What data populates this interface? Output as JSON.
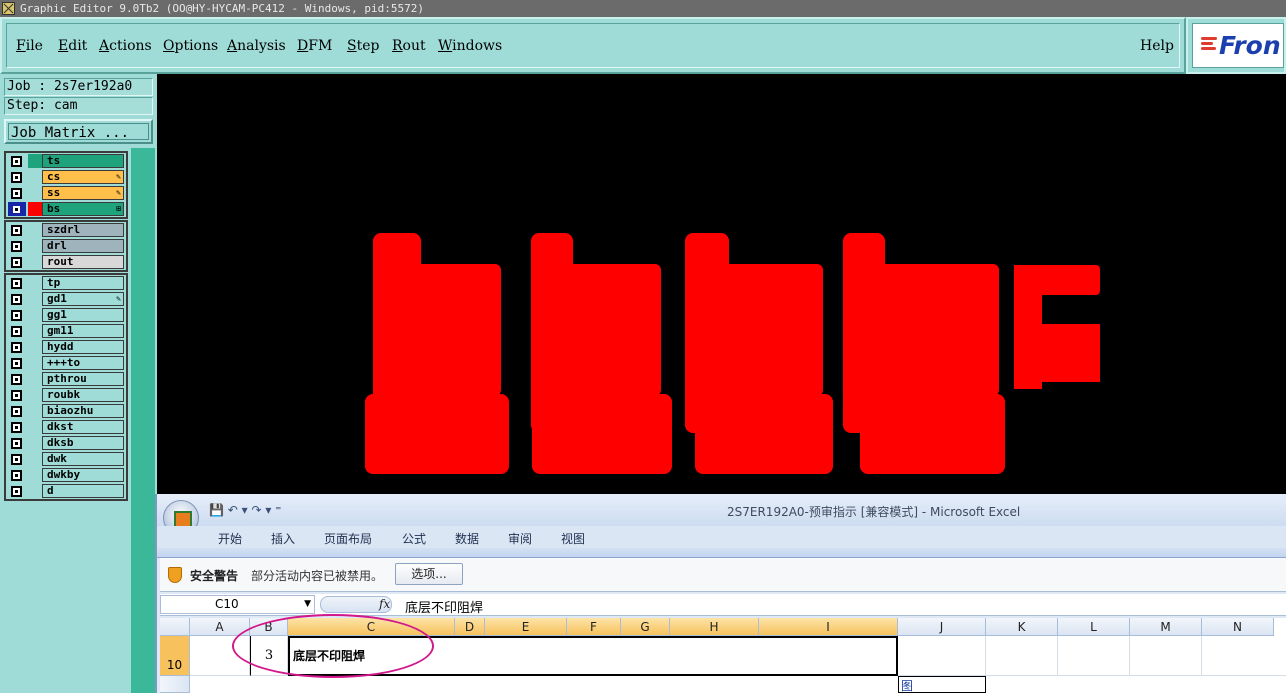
{
  "window": {
    "title": "Graphic Editor 9.0Tb2 (OO@HY-HYCAM-PC412 - Windows, pid:5572)"
  },
  "menu": {
    "items": [
      {
        "label": "File",
        "key": "F",
        "rest": "ile"
      },
      {
        "label": "Edit",
        "key": "E",
        "rest": "dit"
      },
      {
        "label": "Actions",
        "key": "A",
        "rest": "ctions"
      },
      {
        "label": "Options",
        "key": "O",
        "rest": "ptions"
      },
      {
        "label": "Analysis",
        "key": "A",
        "rest": "nalysis"
      },
      {
        "label": "DFM",
        "key": "D",
        "rest": "FM"
      },
      {
        "label": "Step",
        "key": "S",
        "rest": "tep"
      },
      {
        "label": "Rout",
        "key": "R",
        "rest": "out"
      },
      {
        "label": "Windows",
        "key": "W",
        "rest": "indows"
      }
    ],
    "help": "Help"
  },
  "logo": {
    "text": "Fron"
  },
  "panel": {
    "job": "Job : 2s7er192a0",
    "step": "Step: cam",
    "job_matrix": "Job Matrix ..."
  },
  "layers": {
    "group1": [
      {
        "name": "ts",
        "color": "#1fa37c",
        "flag": ""
      },
      {
        "name": "cs",
        "color": "#ffbf4a",
        "flag": "✎"
      },
      {
        "name": "ss",
        "color": "#ffbf4a",
        "flag": "✎"
      },
      {
        "name": "bs",
        "color": "#1fa37c",
        "flag": "⊞"
      }
    ],
    "group2": [
      {
        "name": "szdrl",
        "color": "#9eb3bb"
      },
      {
        "name": "drl",
        "color": "#9eb3bb"
      },
      {
        "name": "rout",
        "color": "#d8d8d8"
      }
    ],
    "group3": [
      {
        "name": "tp",
        "flag": ""
      },
      {
        "name": "gd1",
        "flag": "✎"
      },
      {
        "name": "gg1",
        "flag": ""
      },
      {
        "name": "gm11",
        "flag": ""
      },
      {
        "name": "hydd",
        "flag": ""
      },
      {
        "name": "+++to",
        "flag": ""
      },
      {
        "name": "pthrou",
        "flag": ""
      },
      {
        "name": "roubk",
        "flag": ""
      },
      {
        "name": "biaozhu",
        "flag": ""
      },
      {
        "name": "dkst",
        "flag": ""
      },
      {
        "name": "dksb",
        "flag": ""
      },
      {
        "name": "dwk",
        "flag": ""
      },
      {
        "name": "dwkby",
        "flag": ""
      },
      {
        "name": "d",
        "flag": ""
      }
    ]
  },
  "excel": {
    "title": "2S7ER192A0-预审指示  [兼容模式] - Microsoft Excel",
    "tabs": [
      "开始",
      "插入",
      "页面布局",
      "公式",
      "数据",
      "审阅",
      "视图"
    ],
    "security_label": "安全警告",
    "security_msg": "部分活动内容已被禁用。",
    "options_button": "选项...",
    "name_box": "C10",
    "fx": "fx",
    "formula_value": "底层不印阻焊",
    "columns": [
      "A",
      "B",
      "C",
      "D",
      "E",
      "F",
      "G",
      "H",
      "I",
      "J",
      "K",
      "L",
      "M",
      "N"
    ],
    "row_number": "10",
    "cell_b10": "3",
    "cell_c10": "底层不印阻焊",
    "cell_j11": "图"
  }
}
